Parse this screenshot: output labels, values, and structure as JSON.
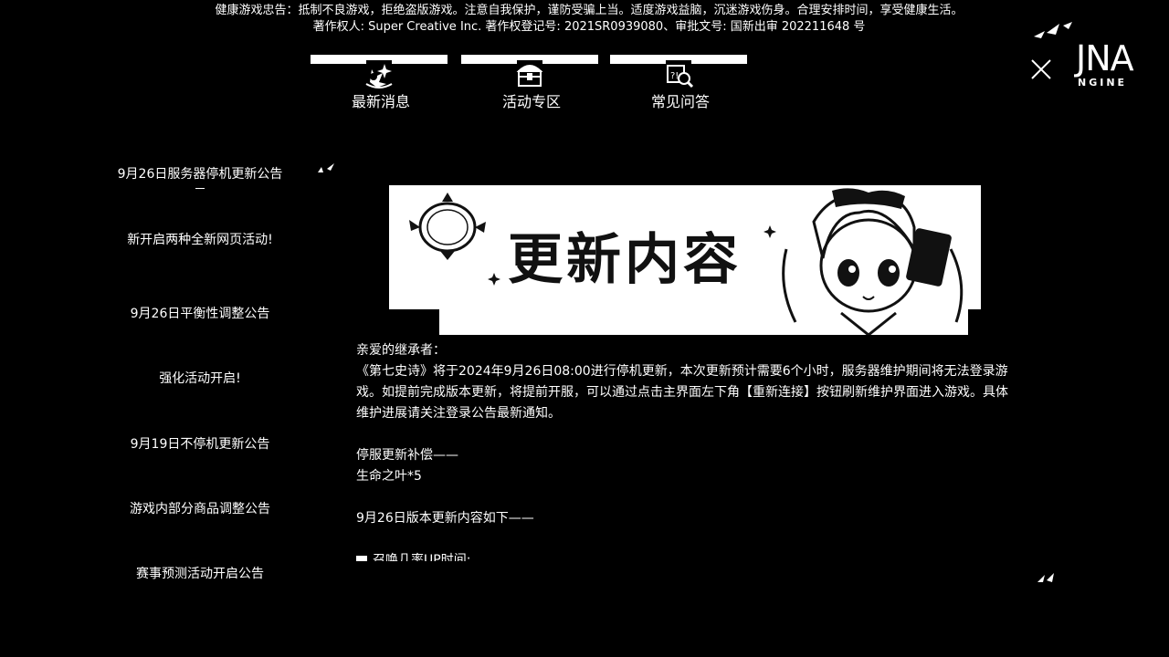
{
  "notice": {
    "line1": "健康游戏忠告：抵制不良游戏，拒绝盗版游戏。注意自我保护，谨防受骗上当。适度游戏益脑，沉迷游戏伤身。合理安排时间，享受健康生活。",
    "line2": "著作权人: Super Creative Inc. 著作权登记号: 2021SR0939080、审批文号: 国新出审 202211648 号"
  },
  "logo": {
    "text": "JNA",
    "sub": "NGINE"
  },
  "tabs": [
    {
      "label": "最新消息",
      "icon": "news-sparkle-icon"
    },
    {
      "label": "活动专区",
      "icon": "treasure-chest-icon"
    },
    {
      "label": "常见问答",
      "icon": "faq-search-icon"
    }
  ],
  "sidebar": {
    "items": [
      {
        "label": "9月26日服务器停机更新公告"
      },
      {
        "label": "新开启两种全新网页活动!"
      },
      {
        "label": "9月26日平衡性调整公告"
      },
      {
        "label": "强化活动开启!"
      },
      {
        "label": "9月19日不停机更新公告"
      },
      {
        "label": "游戏内部分商品调整公告"
      },
      {
        "label": "赛事预测活动开启公告"
      }
    ]
  },
  "article": {
    "banner_title": "更新内容",
    "greeting": "亲爱的继承者：",
    "para1": "《第七史诗》将于2024年9月26日08:00进行停机更新，本次更新预计需要6个小时，服务器维护期间将无法登录游戏。如提前完成版本更新，将提前开服，可以通过点击主界面左下角【重新连接】按钮刷新维护界面进入游戏。具体维护进展请关注登录公告最新通知。",
    "comp_title": "停服更新补偿——",
    "comp_item": "生命之叶*5",
    "update_title": "9月26日版本更新内容如下——",
    "section1": "召唤几率UP时间:"
  }
}
